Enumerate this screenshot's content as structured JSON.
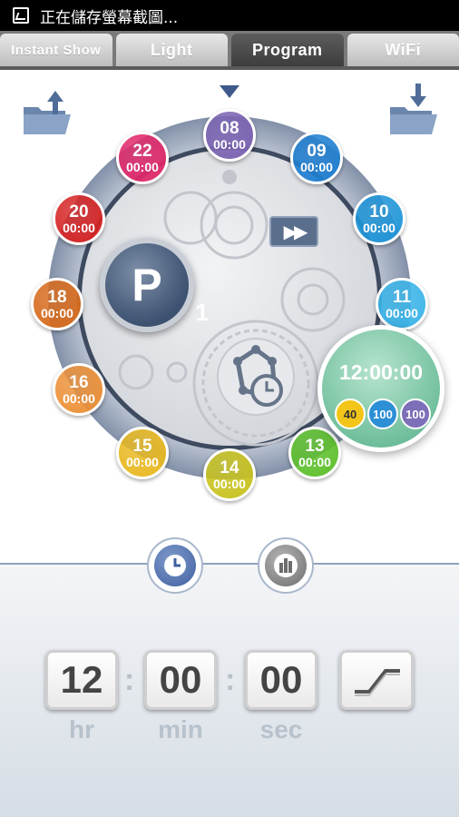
{
  "status_bar": {
    "text": "正在儲存螢幕截圖..."
  },
  "tabs": [
    {
      "label": "Instant Show",
      "active": false
    },
    {
      "label": "Light",
      "active": false
    },
    {
      "label": "Program",
      "active": true
    },
    {
      "label": "WiFi",
      "active": false
    }
  ],
  "toolbar": {
    "upload_icon": "folder-upload-icon",
    "download_icon": "folder-download-icon"
  },
  "program": {
    "letter": "P",
    "number": "1"
  },
  "dial_hours": [
    {
      "hour": "08",
      "time": "00:00",
      "color": "#7b63b2"
    },
    {
      "hour": "09",
      "time": "00:00",
      "color": "#1f7fd0"
    },
    {
      "hour": "10",
      "time": "00:00",
      "color": "#1f95d8"
    },
    {
      "hour": "11",
      "time": "00:00",
      "color": "#3ab4e8"
    },
    {
      "hour": "13",
      "time": "00:00",
      "color": "#5cbf2a"
    },
    {
      "hour": "14",
      "time": "00:00",
      "color": "#c8c21e"
    },
    {
      "hour": "15",
      "time": "00:00",
      "color": "#e8b820"
    },
    {
      "hour": "16",
      "time": "00:00",
      "color": "#ec9036"
    },
    {
      "hour": "18",
      "time": "00:00",
      "color": "#d66a1c"
    },
    {
      "hour": "20",
      "time": "00:00",
      "color": "#d62424"
    },
    {
      "hour": "22",
      "time": "00:00",
      "color": "#e0286a"
    }
  ],
  "active_slot": {
    "time": "12:00:00",
    "chips": [
      {
        "value": "40",
        "color": "#f2c518",
        "text_color": "#333333"
      },
      {
        "value": "100",
        "color": "#2d8fd6",
        "text_color": "#ffffff"
      },
      {
        "value": "100",
        "color": "#7d6fb8",
        "text_color": "#ffffff"
      }
    ]
  },
  "modes": {
    "clock_icon": "clock-icon",
    "levels_icon": "bar-levels-icon"
  },
  "time_setting": {
    "hr": "12",
    "min": "00",
    "sec": "00",
    "hr_label": "hr",
    "min_label": "min",
    "sec_label": "sec",
    "colon": ":"
  },
  "ramp": {
    "icon": "ramp-curve-icon"
  }
}
